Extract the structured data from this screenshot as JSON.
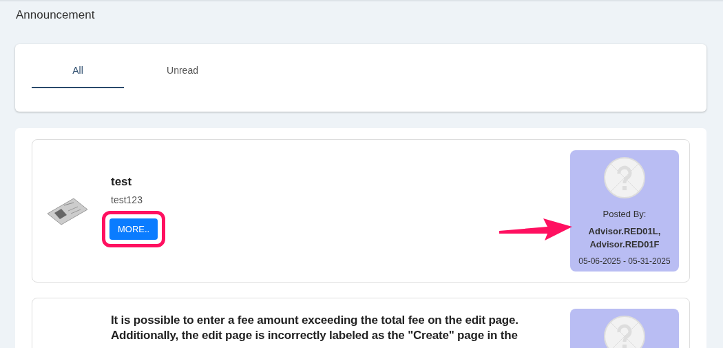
{
  "page_title": "Announcement",
  "tabs": [
    {
      "label": "All",
      "selected": true
    },
    {
      "label": "Unread",
      "selected": false
    }
  ],
  "announcements": [
    {
      "title": "test",
      "description": "test123",
      "button": "MORE..",
      "highlighted": true,
      "pointer_arrow": true,
      "posted_label": "Posted By:",
      "posted_by": "Advisor.RED01L, Advisor.RED01F",
      "dates": "05-06-2025 - 05-31-2025"
    },
    {
      "title": "It is possible to enter a fee amount exceeding the total fee on the edit page. Additionally, the edit page is incorrectly labeled as the \"Create\" page in the"
    }
  ]
}
